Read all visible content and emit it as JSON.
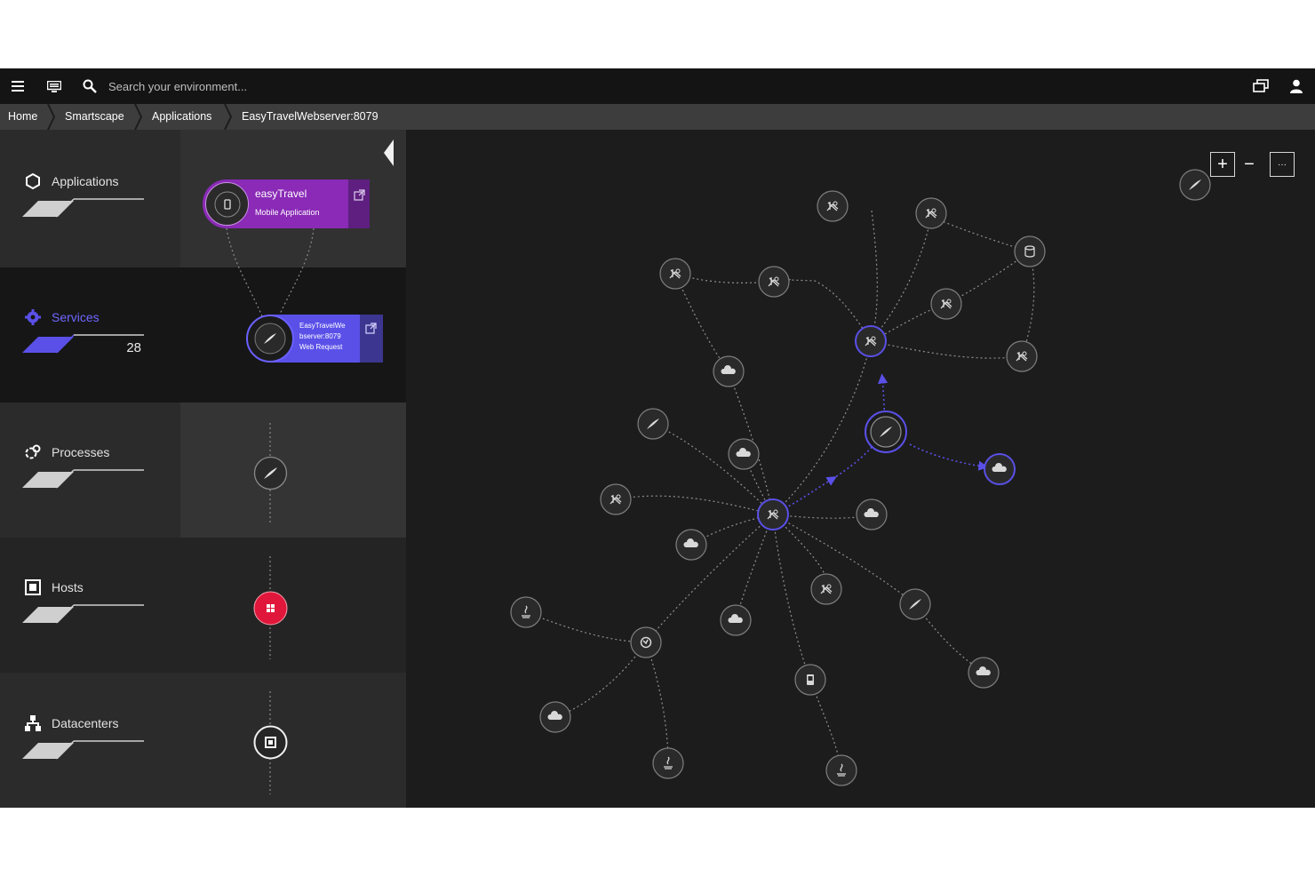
{
  "topbar": {
    "menu_icon": "hamburger-menu-icon",
    "env_icon": "environment-monitor-icon",
    "search_icon": "magnifier-icon",
    "search_placeholder": "Search your environment...",
    "right_icons": [
      "windows-switch-icon",
      "user-icon"
    ]
  },
  "breadcrumb": {
    "items": [
      "Home",
      "Smartscape",
      "Applications",
      "EasyTravelWebserver:8079"
    ]
  },
  "layers": [
    {
      "title": "Applications",
      "icon": "hexagon-icon",
      "active": false
    },
    {
      "title": "Services",
      "icon": "gear-icon",
      "active": true,
      "count": "28"
    },
    {
      "title": "Processes",
      "icon": "processes-icon",
      "active": false
    },
    {
      "title": "Hosts",
      "icon": "host-icon",
      "active": false
    },
    {
      "title": "Datacenters",
      "icon": "datacenter-icon",
      "active": false
    }
  ],
  "vertical_stack": {
    "app_card": {
      "name": "easyTravel",
      "type": "Mobile Application",
      "icon": "mobile-icon",
      "color": "#8a2ab6"
    },
    "service_card": {
      "line1": "EasyTravelWe",
      "line2": "bserver:8079",
      "line3": "Web Request",
      "icon": "feather-icon",
      "color": "#5a4de6"
    },
    "process_icon": "feather-icon",
    "host_icon": "windows-icon",
    "host_color": "#e0173a",
    "datacenter_icon": "datacenter-icon"
  },
  "colors": {
    "accent_blue": "#5a50e8",
    "accent_purple": "#8a2ab6",
    "host_red": "#e0173a",
    "bg_dark": "#1c1c1c"
  },
  "zoom": {
    "plus": "+",
    "minus": "−",
    "more": "···"
  },
  "graph": {
    "node_icons": [
      "feather-icon",
      "bug-icon",
      "cloud-icon",
      "database-icon",
      "globe-icon",
      "java-icon",
      "mobile-icon"
    ],
    "selected_node_icon": "feather-icon"
  }
}
